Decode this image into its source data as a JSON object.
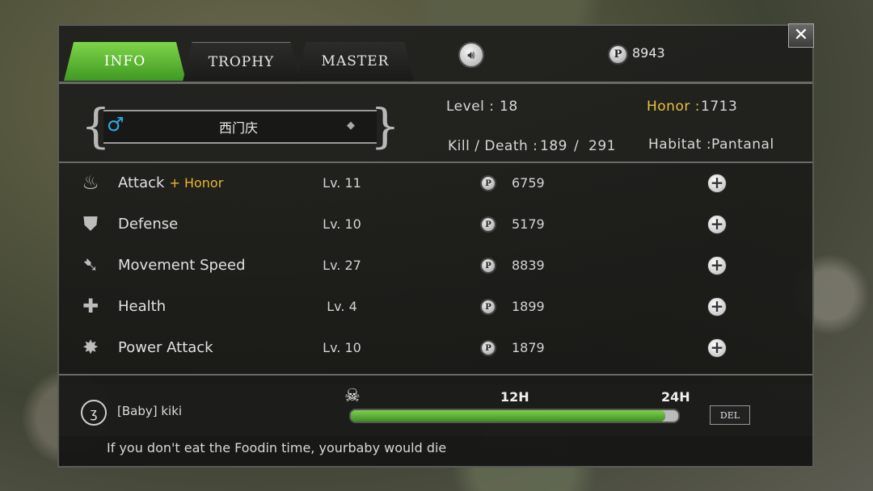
{
  "tabs": [
    {
      "label": "INFO",
      "active": true
    },
    {
      "label": "TROPHY",
      "active": false
    },
    {
      "label": "MASTER",
      "active": false
    }
  ],
  "toolbar": {
    "sound_icon": "speaker-icon",
    "points_symbol": "P",
    "points": "8943",
    "close_symbol": "✕"
  },
  "profile": {
    "gender_icon": "male-icon",
    "gender_symbol": "♂",
    "name": "西门庆",
    "level_label": "Level :",
    "level": "18",
    "honor_label": "Honor :",
    "honor": "1713",
    "kd_label": "Kill / Death :",
    "kills": "189",
    "kd_separator": "/",
    "deaths": "291",
    "habitat_label": "Habitat :",
    "habitat": "Pantanal"
  },
  "stats": [
    {
      "name": "Attack",
      "extra": "+ Honor",
      "level": "Lv. 11",
      "cost": "6759",
      "icon": "flame-claw-icon"
    },
    {
      "name": "Defense",
      "extra": "",
      "level": "Lv. 10",
      "cost": "5179",
      "icon": "shield-icon"
    },
    {
      "name": "Movement Speed",
      "extra": "",
      "level": "Lv. 27",
      "cost": "8839",
      "icon": "wing-icon"
    },
    {
      "name": "Health",
      "extra": "",
      "level": "Lv. 4",
      "cost": "1899",
      "icon": "cross-icon"
    },
    {
      "name": "Power Attack",
      "extra": "",
      "level": "Lv. 10",
      "cost": "1879",
      "icon": "burst-icon"
    }
  ],
  "baby": {
    "icon": "baby-egg-icon",
    "name": "[Baby]  kiki",
    "skull_icon": "skull-crossbones-icon",
    "time_mid": "12H",
    "time_end": "24H",
    "food_fraction": 0.96,
    "del_label": "DEL",
    "hint": "If you don't eat the Foodin time, yourbaby would die"
  },
  "colors": {
    "accent_green": "#4fb02c",
    "honor_gold": "#e6c33d",
    "male_blue": "#2fa8e6"
  }
}
